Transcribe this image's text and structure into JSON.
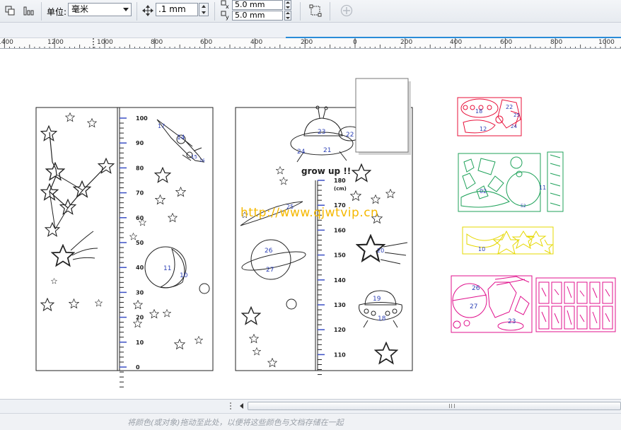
{
  "toolbar": {
    "unit_label": "单位:",
    "unit_value": "毫米",
    "nudge_value": ".1 mm",
    "dup_x_value": "5.0 mm",
    "dup_y_value": "5.0 mm"
  },
  "ruler": {
    "labels": [
      "1400",
      "1200",
      "1000",
      "800",
      "600",
      "400",
      "200",
      "0",
      "200",
      "400",
      "600",
      "800",
      "1000"
    ]
  },
  "canvas": {
    "watermark": "http://www.qjwtvip.cn",
    "growth_chart_1": {
      "ticks": [
        "100",
        "90",
        "80",
        "70",
        "60",
        "50",
        "40",
        "30",
        "20",
        "10",
        "0"
      ],
      "numbers": [
        "17",
        "14",
        "15",
        "16",
        "11",
        "10",
        "15"
      ]
    },
    "growth_chart_2": {
      "title": "grow up !!",
      "ticks": [
        "180",
        "170",
        "160",
        "150",
        "140",
        "130",
        "120",
        "110"
      ],
      "unit": "(cm)",
      "numbers": [
        "23",
        "24",
        "21",
        "22",
        "25",
        "26",
        "27",
        "20",
        "19",
        "18"
      ]
    },
    "parts": {
      "red_numbers": [
        "18",
        "22",
        "12",
        "25",
        "24"
      ],
      "green_numbers": [
        "11",
        "02",
        "52"
      ],
      "yellow_numbers": [
        "10"
      ],
      "magenta_numbers": [
        "26",
        "27",
        "23"
      ]
    }
  },
  "statusbar": {
    "hint": "将颜色(或对象)拖动至此处，以便将这些颜色与文档存储在一起"
  },
  "colors": {
    "red": "#e8103a",
    "green": "#1fa25a",
    "yellow": "#e6d800",
    "magenta": "#e0108c",
    "blue_number": "#2b3fb5"
  }
}
